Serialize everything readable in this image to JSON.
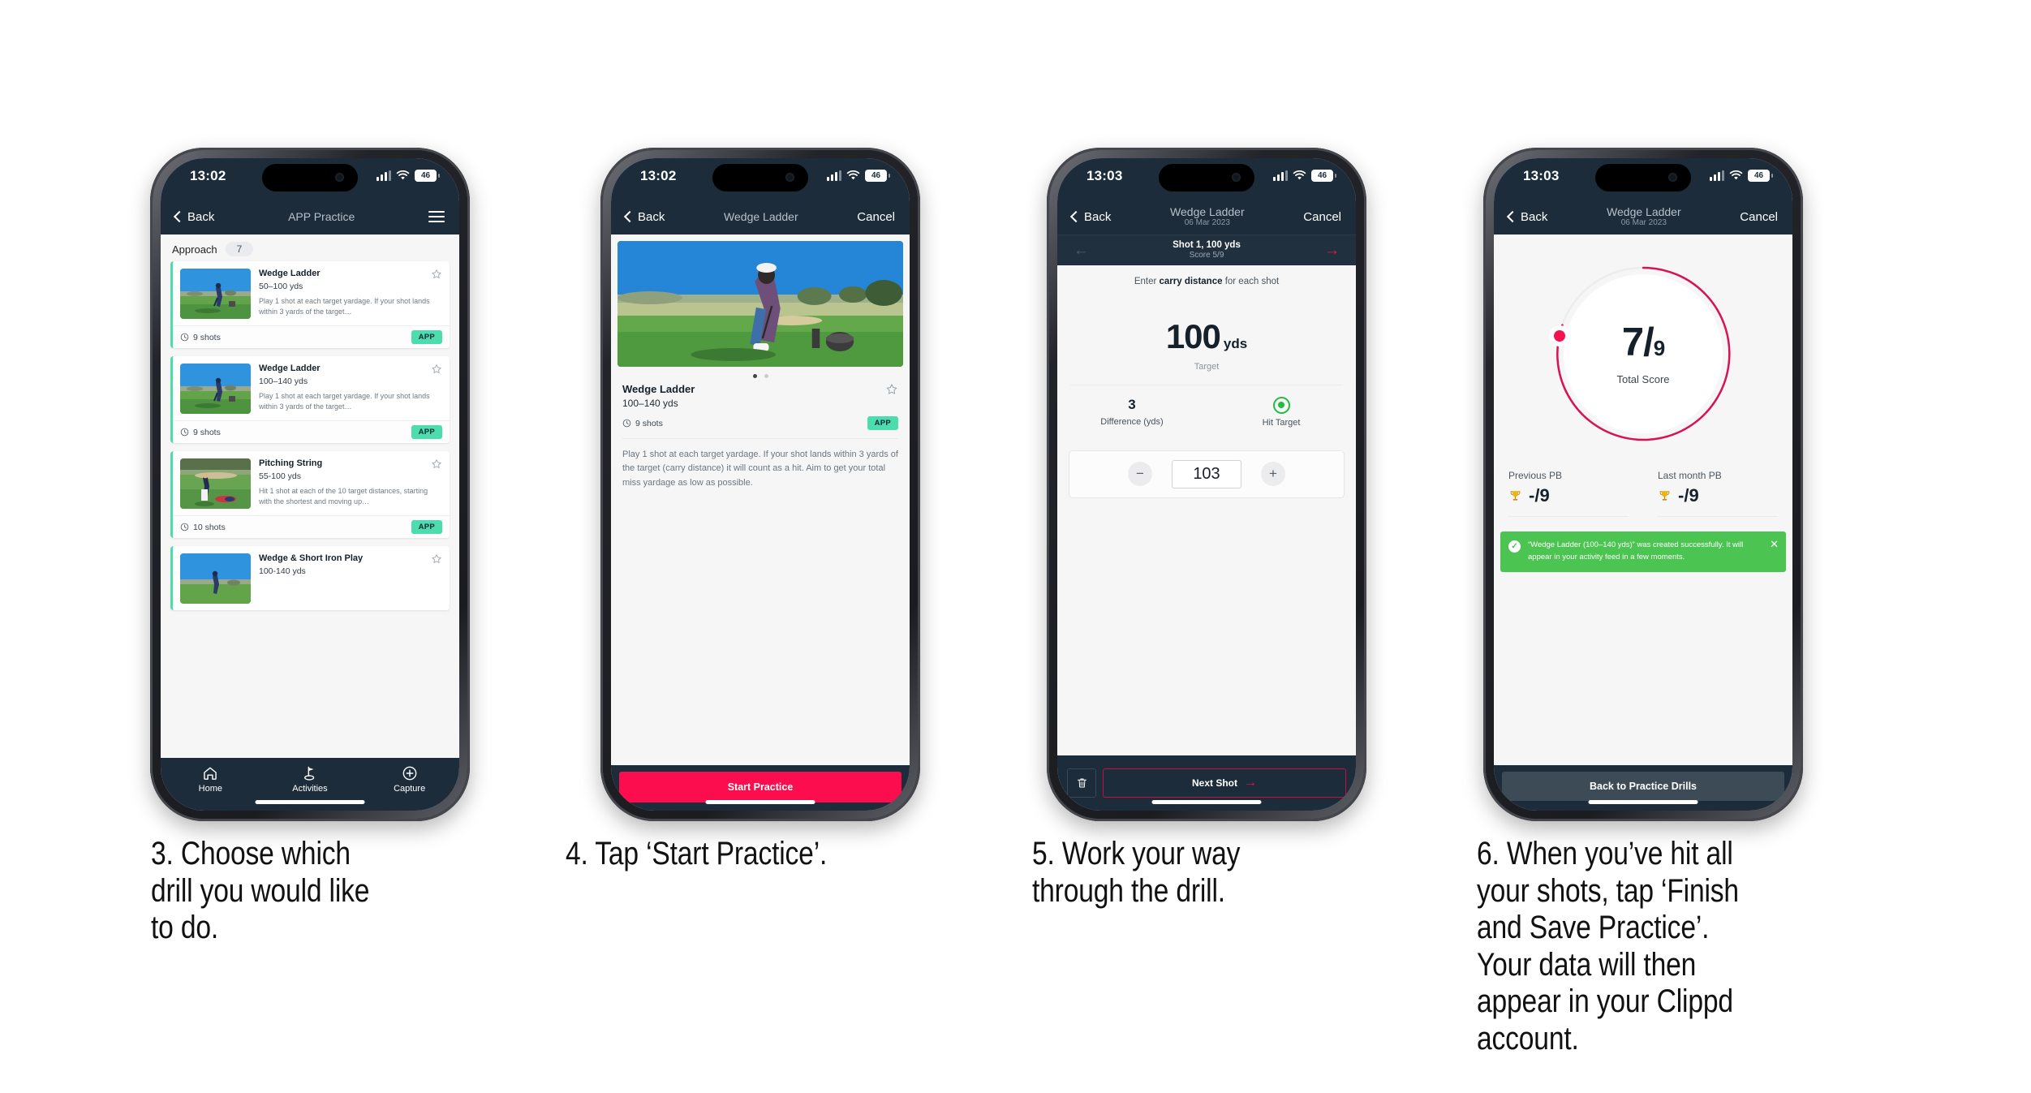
{
  "meta": {
    "brand_pink": "#fb0d4e",
    "brand_mint": "#4cdcae",
    "brand_navy": "#1c2c3b",
    "toast_green": "#4bc451"
  },
  "phones": [
    {
      "id": "phone-app-practice",
      "status": {
        "time": "13:02",
        "battery": "46"
      },
      "nav": {
        "back": "Back",
        "title": "APP Practice",
        "menu_icon": "hamburger-icon"
      },
      "section": {
        "label": "Approach",
        "count": "7"
      },
      "cards": [
        {
          "title": "Wedge Ladder",
          "range": "50–100 yds",
          "desc": "Play 1 shot at each target yardage. If your shot lands within 3 yards of the target…",
          "shots": "9 shots",
          "badge": "APP",
          "scene": "golfer-wedge"
        },
        {
          "title": "Wedge Ladder",
          "range": "100–140 yds",
          "desc": "Play 1 shot at each target yardage. If your shot lands within 3 yards of the target…",
          "shots": "9 shots",
          "badge": "APP",
          "scene": "golfer-wedge"
        },
        {
          "title": "Pitching String",
          "range": "55-100 yds",
          "desc": "Hit 1 shot at each of the 10 target distances, starting with the shortest and moving up…",
          "shots": "10 shots",
          "badge": "APP",
          "scene": "golfer-pitch"
        },
        {
          "title": "Wedge & Short Iron Play",
          "range": "100-140 yds",
          "desc": "",
          "shots": "",
          "badge": "",
          "scene": "golfer-wedge"
        }
      ],
      "tabs": [
        {
          "label": "Home",
          "icon": "home-icon"
        },
        {
          "label": "Activities",
          "icon": "golf-flag-icon"
        },
        {
          "label": "Capture",
          "icon": "plus-circle-icon"
        }
      ]
    },
    {
      "id": "phone-drill-detail",
      "status": {
        "time": "13:02",
        "battery": "46"
      },
      "nav": {
        "back": "Back",
        "title": "Wedge Ladder",
        "cancel": "Cancel"
      },
      "detail": {
        "title": "Wedge Ladder",
        "range": "100–140 yds",
        "shots": "9 shots",
        "badge": "APP",
        "description": "Play 1 shot at each target yardage. If your shot lands within 3 yards of the target (carry distance) it will count as a hit. Aim to get your total miss yardage as low as possible.",
        "dots": 2,
        "active_dot": 0
      },
      "cta": "Start Practice"
    },
    {
      "id": "phone-shot-entry",
      "status": {
        "time": "13:03",
        "battery": "46"
      },
      "nav": {
        "back": "Back",
        "title": "Wedge Ladder",
        "subtitle": "06 Mar 2023",
        "cancel": "Cancel"
      },
      "shotbar": {
        "title": "Shot 1, 100 yds",
        "score": "Score 5/9",
        "prev_icon": "arrow-left-icon",
        "next_icon": "arrow-right-icon"
      },
      "prompt_before": "Enter ",
      "prompt_bold": "carry distance",
      "prompt_after": " for each shot",
      "target": {
        "value": "100",
        "unit": "yds",
        "label": "Target"
      },
      "stats": [
        {
          "value": "3",
          "label": "Difference (yds)"
        },
        {
          "value": "",
          "label": "Hit Target",
          "icon": "hit-target-dot-icon"
        }
      ],
      "stepper": {
        "minus": "−",
        "value": "103",
        "plus": "+"
      },
      "footer": {
        "delete_icon": "trash-icon",
        "next": "Next Shot"
      }
    },
    {
      "id": "phone-results",
      "status": {
        "time": "13:03",
        "battery": "46"
      },
      "nav": {
        "back": "Back",
        "title": "Wedge Ladder",
        "subtitle": "06 Mar 2023",
        "cancel": "Cancel"
      },
      "ring": {
        "score": "7",
        "slash": "/",
        "denominator": "9",
        "label": "Total Score",
        "percent": 78
      },
      "pbs": [
        {
          "label": "Previous PB",
          "value": "-/9",
          "icon": "trophy-icon"
        },
        {
          "label": "Last month PB",
          "value": "-/9",
          "icon": "trophy-icon"
        }
      ],
      "toast": {
        "message": "“Wedge Ladder (100–140 yds)” was created successfully. It will appear in your activity feed in a few moments.",
        "check_icon": "check-circle-icon",
        "close_icon": "close-icon"
      },
      "footer_button": "Back to Practice Drills"
    }
  ],
  "captions": [
    "3. Choose which drill you would like to do.",
    "4. Tap ‘Start Practice’.",
    "5. Work your way through the drill.",
    "6. When you’ve hit all your shots, tap ‘Finish and Save Practice’. Your data will then appear in your Clippd account."
  ]
}
